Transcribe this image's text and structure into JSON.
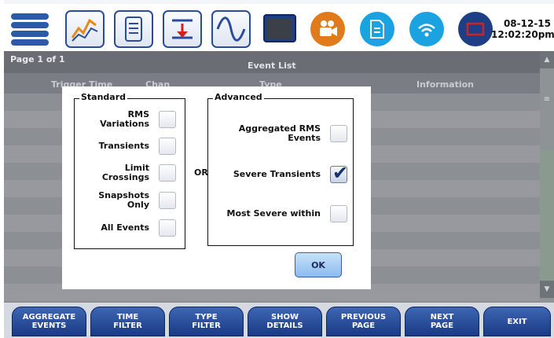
{
  "toolbar": {
    "icons": [
      "menu-icon",
      "trend-chart-icon",
      "scroll-document-icon",
      "limit-filter-icon",
      "waveform-icon",
      "monitor-icon",
      "camera-icon",
      "document-icon",
      "wifi-icon",
      "screen-icon"
    ],
    "date": "08-12-15",
    "time": "12:02:20pm"
  },
  "event_list": {
    "page_label": "Page 1 of 1",
    "title": "Event List",
    "columns": [
      "Trigger Time",
      "Chan",
      "Type",
      "Information"
    ]
  },
  "dialog": {
    "standard": {
      "title": "Standard",
      "options": [
        {
          "label": "RMS Variations",
          "checked": false
        },
        {
          "label": "Transients",
          "checked": false
        },
        {
          "label": "Limit Crossings",
          "checked": false
        },
        {
          "label_line1": "Snapshots",
          "label_line2": "Only",
          "checked": false
        },
        {
          "label": "All Events",
          "checked": false
        }
      ]
    },
    "or_label": "OR",
    "advanced": {
      "title": "Advanced",
      "options": [
        {
          "label": "Aggregated RMS Events",
          "checked": false
        },
        {
          "label": "Severe Transients",
          "checked": true
        },
        {
          "label": "Most Severe within",
          "checked": false
        }
      ]
    },
    "ok_label": "OK"
  },
  "bottom_bar": {
    "buttons": [
      {
        "line1": "AGGREGATE",
        "line2": "EVENTS"
      },
      {
        "line1": "TIME",
        "line2": "FILTER"
      },
      {
        "line1": "TYPE",
        "line2": "FILTER"
      },
      {
        "line1": "SHOW",
        "line2": "DETAILS"
      },
      {
        "line1": "PREVIOUS",
        "line2": "PAGE"
      },
      {
        "line1": "NEXT",
        "line2": "PAGE"
      },
      {
        "line1": "EXIT",
        "line2": ""
      }
    ]
  },
  "colors": {
    "toolbar_blue": "#2a4c9d",
    "orange_icon": "#e07a1a",
    "cyan_icon": "#1aa3e0",
    "button_blue": "#1a3a84",
    "check_blue": "#14306e"
  }
}
